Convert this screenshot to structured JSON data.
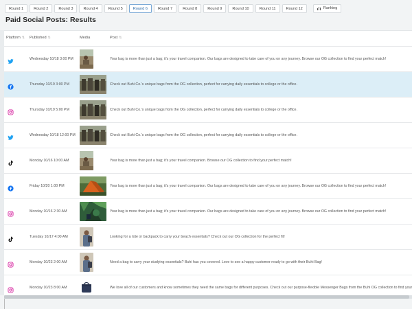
{
  "tabs": [
    {
      "label": "Round 1",
      "active": false
    },
    {
      "label": "Round 2",
      "active": false
    },
    {
      "label": "Round 3",
      "active": false
    },
    {
      "label": "Round 4",
      "active": false
    },
    {
      "label": "Round 5",
      "active": false
    },
    {
      "label": "Round 6",
      "active": true
    },
    {
      "label": "Round 7",
      "active": false
    },
    {
      "label": "Round 8",
      "active": false
    },
    {
      "label": "Round 9",
      "active": false
    },
    {
      "label": "Round 10",
      "active": false
    },
    {
      "label": "Round 11",
      "active": false
    },
    {
      "label": "Round 12",
      "active": false
    }
  ],
  "ranking_label": "Ranking",
  "page_title": "Paid Social Posts: Results",
  "columns": {
    "platform": "Platform",
    "published": "Published",
    "media": "Media",
    "post": "Post"
  },
  "colors": {
    "twitter": "#1da1f2",
    "facebook": "#1877f2",
    "instagram": "#d6249f",
    "tiktok": "#111111",
    "selected_row": "#dceef7"
  },
  "rows": [
    {
      "platform": "twitter",
      "icon": "twitter-icon",
      "date": "Wednesday 10/18 3:00 PM",
      "media": "photo-narrow",
      "post": "Your bag is more than just a bag; it's your travel companion. Our bags are designed to take care of you on any journey. Browse our OG collection to find your perfect match!",
      "selected": false
    },
    {
      "platform": "facebook",
      "icon": "facebook-icon",
      "date": "Thursday 10/19 3:00 PM",
      "media": "photo-wide",
      "post": "Check out Buhi Co.'s unique bags from the OG collection, perfect for carrying daily essentials to college or the office.",
      "selected": true
    },
    {
      "platform": "instagram",
      "icon": "instagram-icon",
      "date": "Thursday 10/19 5:00 PM",
      "media": "photo-wide",
      "post": "Check out Buhi Co.'s unique bags from the OG collection, perfect for carrying daily essentials to college or the office.",
      "selected": false
    },
    {
      "platform": "twitter",
      "icon": "twitter-icon",
      "date": "Wednesday 10/18 12:00 PM",
      "media": "photo-wide",
      "post": "Check out Buhi Co.'s unique bags from the OG collection, perfect for carrying daily essentials to college or the office.",
      "selected": false
    },
    {
      "platform": "tiktok",
      "icon": "tiktok-icon",
      "date": "Monday 10/16 10:00 AM",
      "media": "photo-narrow",
      "post": "Your bag is more than just a bag; it's your travel companion. Browse our OG collection to find your perfect match!",
      "selected": false
    },
    {
      "platform": "facebook",
      "icon": "facebook-icon",
      "date": "Friday 10/20 1:00 PM",
      "media": "photo-tent",
      "post": "Your bag is more than just a bag; it's your travel companion. Our bags are designed to take care of you on any journey. Browse our OG collection to find your perfect match!",
      "selected": false
    },
    {
      "platform": "instagram",
      "icon": "instagram-icon",
      "date": "Monday 10/16 2:30 AM",
      "media": "photo-green",
      "post": "Your bag is more than just a bag; it's your travel companion. Our bags are designed to take care of you on any journey. Browse our OG collection to find your perfect match!",
      "selected": false
    },
    {
      "platform": "tiktok",
      "icon": "tiktok-icon",
      "date": "Tuesday 10/17 4:00 AM",
      "media": "photo-person",
      "post": "Looking for a tote or backpack to carry your beach essentials? Check out our OG collection for the perfect fit!",
      "selected": false
    },
    {
      "platform": "instagram",
      "icon": "instagram-icon",
      "date": "Monday 10/23 2:00 AM",
      "media": "photo-person",
      "post": "Need a bag to carry your studying essentials? Buhi has you covered. Love to see a happy customer ready to go with their Buhi Bag!",
      "selected": false
    },
    {
      "platform": "instagram",
      "icon": "instagram-icon",
      "date": "Monday 10/23 8:00 AM",
      "media": "photo-bag",
      "post": "We love all of our customers and know sometimes they need the same bags for different purposes. Check out our purpose-flexible Messenger Bags from the Buhi OG collection to find yours",
      "selected": false
    }
  ]
}
